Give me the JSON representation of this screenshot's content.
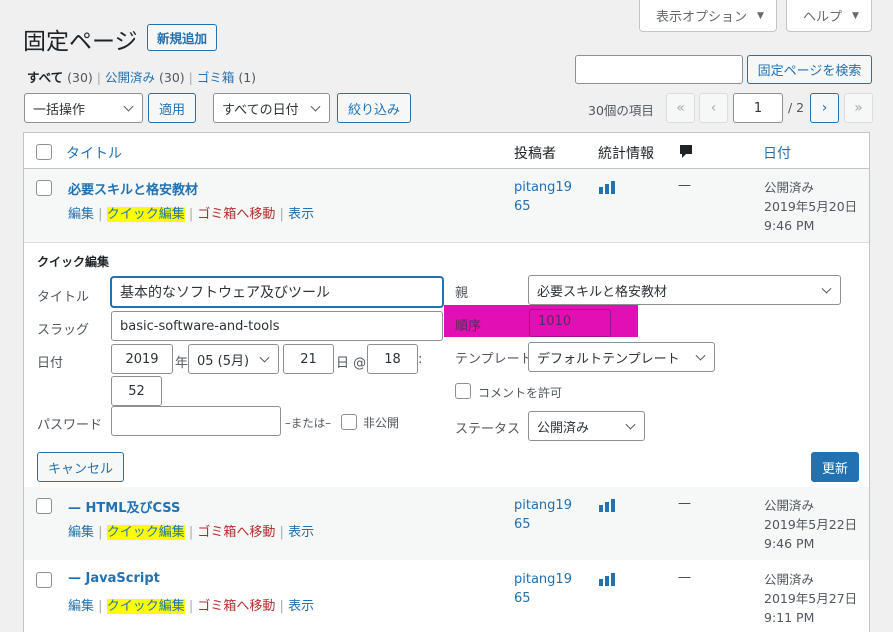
{
  "header": {
    "page_title": "固定ページ",
    "add_new": "新規追加",
    "screen_options": "表示オプション",
    "help": "ヘルプ"
  },
  "filters": {
    "all_label": "すべて",
    "all_count": "(30)",
    "published_label": "公開済み",
    "published_count": "(30)",
    "trash_label": "ゴミ箱",
    "trash_count": "(1)",
    "sep": "|"
  },
  "search": {
    "value": "",
    "button": "固定ページを検索"
  },
  "toolbar": {
    "bulk_action": "一括操作",
    "apply": "適用",
    "date_filter": "すべての日付",
    "filter_button": "絞り込み",
    "items_count": "30個の項目",
    "first_page": "«",
    "prev_page": "‹",
    "current_page": "1",
    "total_pages": "/ 2",
    "next_page": "›",
    "last_page": "»"
  },
  "columns": {
    "title": "タイトル",
    "author": "投稿者",
    "stats": "統計情報",
    "date": "日付"
  },
  "row_actions": {
    "edit": "編集",
    "quick_edit": "クイック編集",
    "trash": "ゴミ箱へ移動",
    "view": "表示",
    "sep": "|"
  },
  "rows": [
    {
      "title": "必要スキルと格安教材",
      "author": "pitang1965",
      "stats": "—",
      "status": "公開済み",
      "date": "2019年5月20日",
      "time": "9:46 PM"
    },
    {
      "title": "— HTML及びCSS",
      "author": "pitang1965",
      "stats": "—",
      "status": "公開済み",
      "date": "2019年5月22日",
      "time": "9:46 PM"
    },
    {
      "title": "— JavaScript",
      "author": "pitang1965",
      "stats": "—",
      "status": "公開済み",
      "date": "2019年5月27日",
      "time": "9:11 PM"
    }
  ],
  "quick_edit": {
    "heading": "クイック編集",
    "title_label": "タイトル",
    "title_value": "基本的なソフトウェア及びツール",
    "slug_label": "スラッグ",
    "slug_value": "basic-software-and-tools",
    "date_label": "日付",
    "year": "2019",
    "year_suffix": "年",
    "month": "05 (5月)",
    "day": "21",
    "day_suffix": "日 @",
    "hour": "18",
    "colon": ":",
    "minute": "52",
    "password_label": "パスワード",
    "password_value": "",
    "or_label": "–または–",
    "private_label": "非公開",
    "parent_label": "親",
    "parent_value": "必要スキルと格安教材",
    "order_label": "順序",
    "order_value": "1010",
    "template_label": "テンプレート",
    "template_value": "デフォルトテンプレート",
    "allow_comments": "コメントを許可",
    "status_label": "ステータス",
    "status_value": "公開済み",
    "cancel": "キャンセル",
    "update": "更新"
  },
  "colors": {
    "accent": "#2271b1",
    "highlight_yellow": "#ffff00",
    "highlight_magenta": "#e10fb4",
    "trash_red": "#b32d2e"
  }
}
